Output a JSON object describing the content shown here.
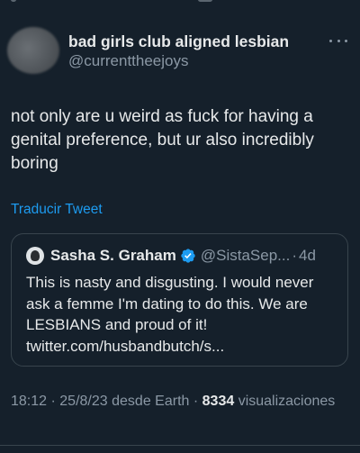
{
  "tweet": {
    "author": {
      "display_name": "bad girls club aligned lesbian",
      "handle": "@currenttheejoys"
    },
    "text": "not only are u weird as fuck for having a genital preference, but ur also incredibly boring",
    "translate_label": "Traducir Tweet",
    "quoted": {
      "display_name": "Sasha S. Graham",
      "handle": "@SistaSep...",
      "separator": "·",
      "time": "4d",
      "text": "This is nasty and disgusting. I would never ask a femme I'm dating to do this. We are LESBIANS and proud of it! twitter.com/husbandbutch/s..."
    },
    "meta": {
      "time": "18:12",
      "separator1": "·",
      "date": "25/8/23",
      "source": "desde Earth",
      "separator2": "·",
      "views_count": "8334",
      "views_label": "visualizaciones"
    },
    "icons": {
      "more": "more-horizontal-icon",
      "verified": "verified-badge-icon"
    },
    "colors": {
      "background": "#15202b",
      "link": "#1d9bf0",
      "secondary_text": "#8b98a5",
      "verified_badge": "#1d9bf0"
    }
  }
}
